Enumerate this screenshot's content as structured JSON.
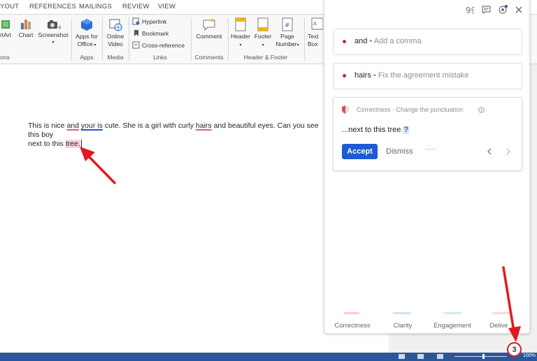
{
  "tabs": [
    "YOUT",
    "REFERENCES",
    "MAILINGS",
    "REVIEW",
    "VIEW"
  ],
  "ribbon": {
    "smartart": "rtArt",
    "chart": "Chart",
    "screenshot": "Screenshot",
    "apps_line1": "Apps for",
    "apps_line2": "Office",
    "online_line1": "Online",
    "online_line2": "Video",
    "hyperlink": "Hyperlink",
    "bookmark": "Bookmark",
    "cross_reference": "Cross-reference",
    "comment": "Comment",
    "header": "Header",
    "footer": "Footer",
    "page_line1": "Page",
    "page_line2": "Number",
    "textbox_line1": "Text",
    "textbox_line2": "Box",
    "groups": {
      "illustrations": "ons",
      "apps": "Apps",
      "media": "Media",
      "links": "Links",
      "comments": "Comments",
      "header_footer": "Header & Footer"
    }
  },
  "document": {
    "p1_a": "This is nice ",
    "p1_and": "and",
    "p1_b": " ",
    "p1_your": "your is",
    "p1_c": " cute. She is a girl with curly ",
    "p1_hairs": "hairs",
    "p1_d": " and beautiful eyes. Can you see this boy",
    "p2_a": "next to this ",
    "p2_tree": "tree."
  },
  "panel": {
    "suggestion1": {
      "word": "and",
      "hint": "• Add a comma"
    },
    "suggestion2": {
      "word": "hairs",
      "hint": "• Fix the agreement mistake"
    },
    "card": {
      "category": "Correctness · Change the punctuation",
      "preview": "...next to this tree",
      "preview_mark": "?",
      "accept": "Accept",
      "dismiss": "Dismiss",
      "more": "···"
    },
    "bottom_tabs": [
      "Correctness",
      "Clarity",
      "Engagement",
      "Delive"
    ]
  },
  "status": {
    "zoom": "100%",
    "badge": "3"
  },
  "colors": {
    "accent": "#1e5ad3",
    "error": "#d0293b",
    "status_bar": "#2b579a",
    "annotation": "#e2191f"
  }
}
